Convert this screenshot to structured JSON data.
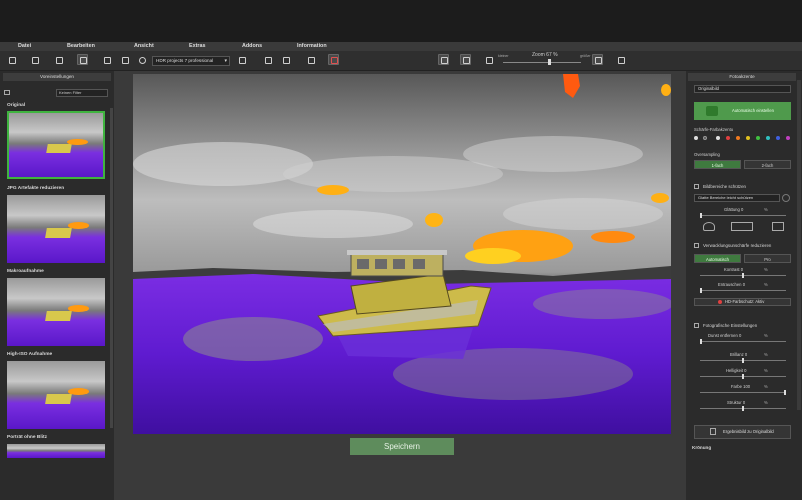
{
  "menu": [
    "Datei",
    "Bearbeiten",
    "Ansicht",
    "Extras",
    "Addons",
    "Information"
  ],
  "toolbar": {
    "preset": "HDR projects 7 professional",
    "zoom_label": "Zoom 67",
    "zoom_pct": "%",
    "zoom_min": "kleiner",
    "zoom_max": "größer",
    "zoom_level": 67
  },
  "left": {
    "header": "Voreinstellungen",
    "filter": "Keinen Filter",
    "presets": [
      "Original",
      "JPG Artefakte reduzieren",
      "Makroaufnahme",
      "High-ISO Aufnahme",
      "Porträt ohne Blitz"
    ]
  },
  "save_label": "Speichern",
  "right": {
    "header": "Fotoakzente",
    "source": "Originalbild",
    "auto_btn": "Automatisch einstellen",
    "sharp_label": "Schärfe-Farbakzentu",
    "oversampling_label": "Oversampling",
    "oversampling": [
      "1-fach",
      "2-fach"
    ],
    "protect_label": "Bildbereiche schützen",
    "protect_select": "Glatte Bereiche leicht schützen",
    "smooth_label": "Glättung",
    "smooth_value": "0",
    "noise_label": "Verwacklungsunschärfe reduzieren",
    "noise_seg": [
      "Automatisch",
      "Pro"
    ],
    "kontrast_label": "Kontrast",
    "kontrast_value": "0",
    "rauschen_label": "Entrauschen",
    "rauschen_value": "0",
    "hdr_btn": "HD-Farbschutz: Aktiv",
    "foto_label": "Fotografische Einstellungen",
    "dunst_label": "Dunst entfernen",
    "dunst_value": "0",
    "brillanz_label": "Brillanz",
    "brillanz_value": "0",
    "hell_label": "Helligkeit",
    "hell_value": "0",
    "farbe_label": "Farbe",
    "farbe_value": "100",
    "struktur_label": "Struktur",
    "struktur_value": "0",
    "pct": "%",
    "copy_btn": "Ergebnisbild zu Originalbild",
    "kroenung": "Krönung"
  },
  "colors": {
    "accent_green": "#4f9a4c",
    "save_green": "#5e8c5c",
    "purple": "#5a17c9",
    "orange": "#ff9a10"
  }
}
